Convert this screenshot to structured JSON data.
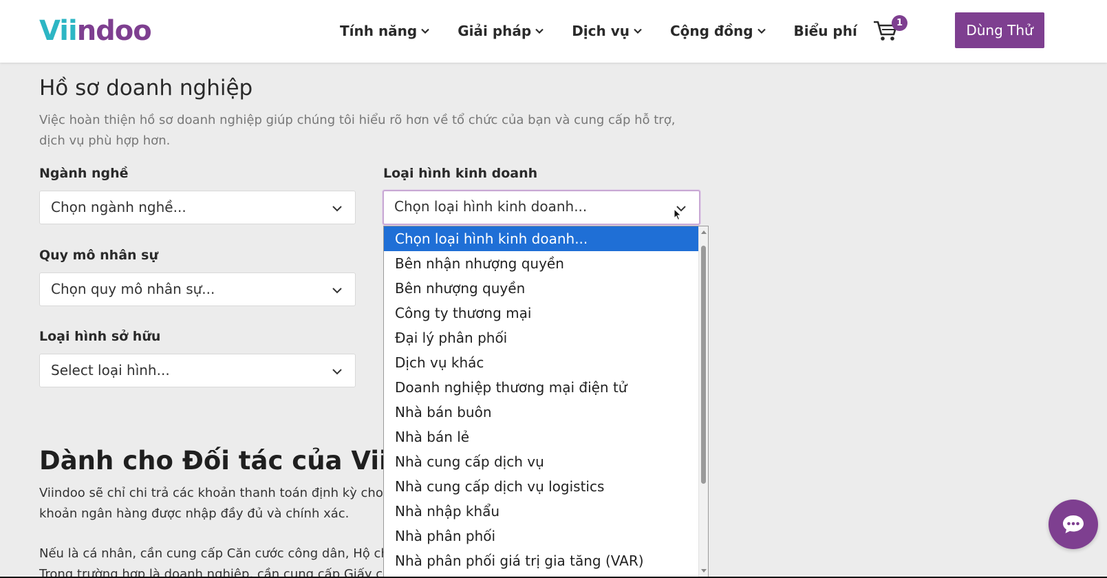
{
  "nav": {
    "logo_part1": "Vi",
    "logo_part2": "i",
    "logo_part3": "ndoo",
    "items": [
      {
        "label": "Tính năng",
        "has_dropdown": true
      },
      {
        "label": "Giải pháp",
        "has_dropdown": true
      },
      {
        "label": "Dịch vụ",
        "has_dropdown": true
      },
      {
        "label": "Cộng đồng",
        "has_dropdown": true
      },
      {
        "label": "Biểu phí",
        "has_dropdown": false
      }
    ],
    "cart_count": "1",
    "cta_label": "Dùng Thử"
  },
  "profile": {
    "title": "Hồ sơ doanh nghiệp",
    "description": "Việc hoàn thiện hồ sơ doanh nghiệp giúp chúng tôi hiểu rõ hơn về tổ chức của bạn và cung cấp hỗ trợ, dịch vụ phù hợp hơn.",
    "fields": {
      "industry": {
        "label": "Ngành nghề",
        "value": "Chọn ngành nghề..."
      },
      "business_type": {
        "label": "Loại hình kinh doanh",
        "value": "Chọn loại hình kinh doanh..."
      },
      "headcount": {
        "label": "Quy mô nhân sự",
        "value": "Chọn quy mô nhân sự..."
      },
      "ownership": {
        "label": "Loại hình sở hữu",
        "value": "Select loại hình..."
      }
    }
  },
  "dropdown": {
    "options": [
      "Chọn loại hình kinh doanh...",
      "Bên nhận nhượng quyền",
      "Bên nhượng quyền",
      "Công ty thương mại",
      "Đại lý phân phối",
      "Dịch vụ khác",
      "Doanh nghiệp thương mại điện tử",
      "Nhà bán buôn",
      "Nhà bán lẻ",
      "Nhà cung cấp dịch vụ",
      "Nhà cung cấp dịch vụ logistics",
      "Nhà nhập khẩu",
      "Nhà phân phối",
      "Nhà phân phối giá trị gia tăng (VAR)"
    ],
    "selected_index": 0
  },
  "partner": {
    "title": "Dành cho Đối tác của Viindoo",
    "para1_line1": "Viindoo sẽ chỉ chi trả các khoản thanh toán định kỳ cho",
    "para1_line2": "khoản ngân hàng được nhập đầy đủ và chính xác.",
    "para2_line1": "Nếu là cá nhân, cần cung cấp Căn cước công dân, Hộ chiếu",
    "para2_line2": "Trong trường hợp là doanh nghiệp, cần cung cấp Giấy chứng"
  },
  "colors": {
    "brand_purple": "#7e3f90",
    "brand_teal": "#2db6c4",
    "selected_option": "#1f6fd6"
  }
}
